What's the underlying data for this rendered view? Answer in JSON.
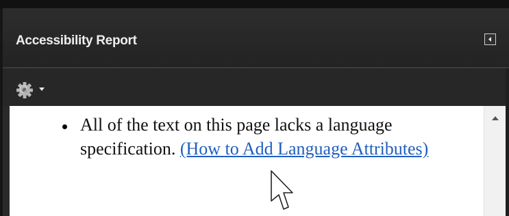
{
  "panel": {
    "title": "Accessibility Report"
  },
  "toolbar": {
    "options_icon": "gear-icon",
    "dropdown_icon": "caret-down-icon"
  },
  "header": {
    "collapse_icon": "collapse-left-icon"
  },
  "report": {
    "items": [
      {
        "text": "All of the text on this page lacks a language specification.",
        "link_label": "(How to Add Language Attributes)"
      }
    ]
  },
  "colors": {
    "panel_bg": "#272727",
    "header_bg": "#2d2d2d",
    "title_text": "#eeeeee",
    "content_bg": "#ffffff",
    "link": "#1f5fbf"
  }
}
